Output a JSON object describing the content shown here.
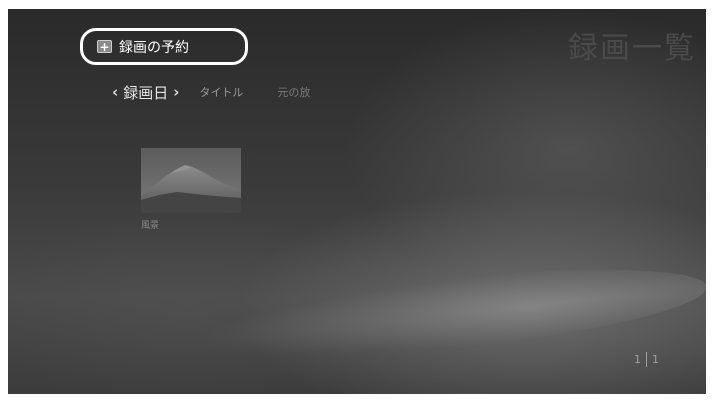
{
  "header": {
    "title": "録画一覧"
  },
  "actions": {
    "schedule_label": "録画の予約",
    "schedule_icon": "plus-icon"
  },
  "sort_tabs": {
    "prev_arrow": "‹",
    "next_arrow": "›",
    "active": "録画日",
    "items": [
      "タイトル",
      "元の放"
    ]
  },
  "recordings": [
    {
      "title": "風景",
      "thumbnail": "mountain-landscape"
    }
  ],
  "pager": {
    "current": "1",
    "total": "1"
  },
  "colors": {
    "background": "#333333",
    "focus_outline": "#ffffff",
    "text_primary": "#ffffff",
    "text_dim": "#9a9a9a"
  }
}
